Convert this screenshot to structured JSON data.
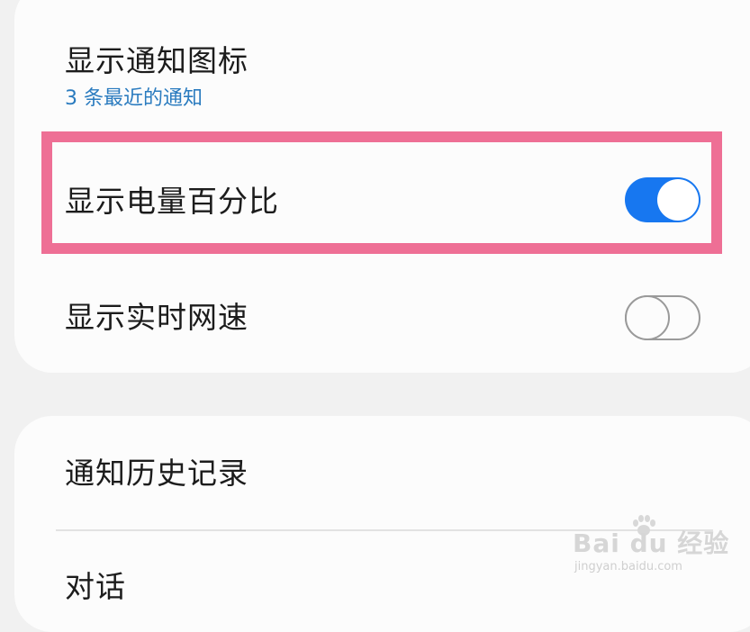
{
  "settings": {
    "notif_icons": {
      "title": "显示通知图标",
      "subtitle": "3 条最近的通知"
    },
    "battery_percent": {
      "title": "显示电量百分比",
      "toggle_state": "on"
    },
    "net_speed": {
      "title": "显示实时网速",
      "toggle_state": "off"
    },
    "notif_history": {
      "title": "通知历史记录"
    },
    "conversations": {
      "title": "对话"
    }
  },
  "watermark": {
    "brand": "Bai du 经验",
    "url": "jingyan.baidu.com"
  },
  "colors": {
    "accent": "#1777f0",
    "subtitle": "#2a7bbf",
    "highlight": "#ee6f95",
    "background": "#f1f1f1",
    "card": "#fcfcfc"
  }
}
